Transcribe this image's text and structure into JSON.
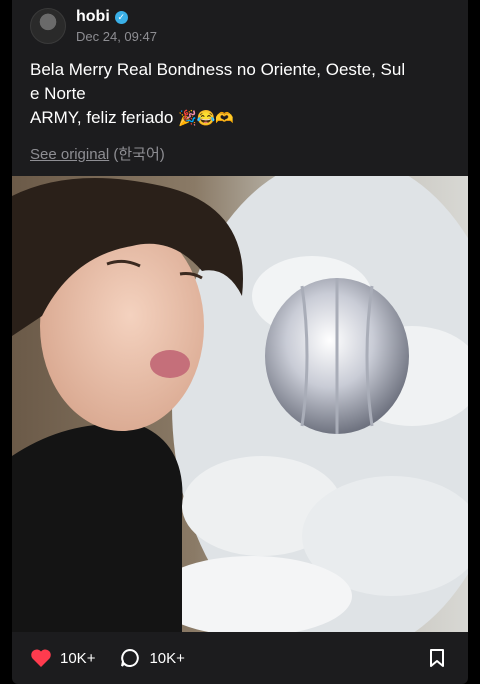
{
  "post": {
    "author": "hobi",
    "timestamp": "Dec 24, 09:47",
    "verified": true,
    "text_lines": [
      "Bela Merry Real Bondness no Oriente, Oeste, Sul",
      "e Norte",
      "ARMY, feliz feriado"
    ],
    "emojis": "🎉😂🫶",
    "translate": {
      "link": "See original",
      "language": "(한국어)"
    }
  },
  "stats": {
    "likes": "10K+",
    "comments": "10K+"
  },
  "colors": {
    "card_bg": "#1c1c1e",
    "like": "#ff3b4e",
    "verified": "#3ab0e8",
    "muted": "#8e8e93"
  }
}
